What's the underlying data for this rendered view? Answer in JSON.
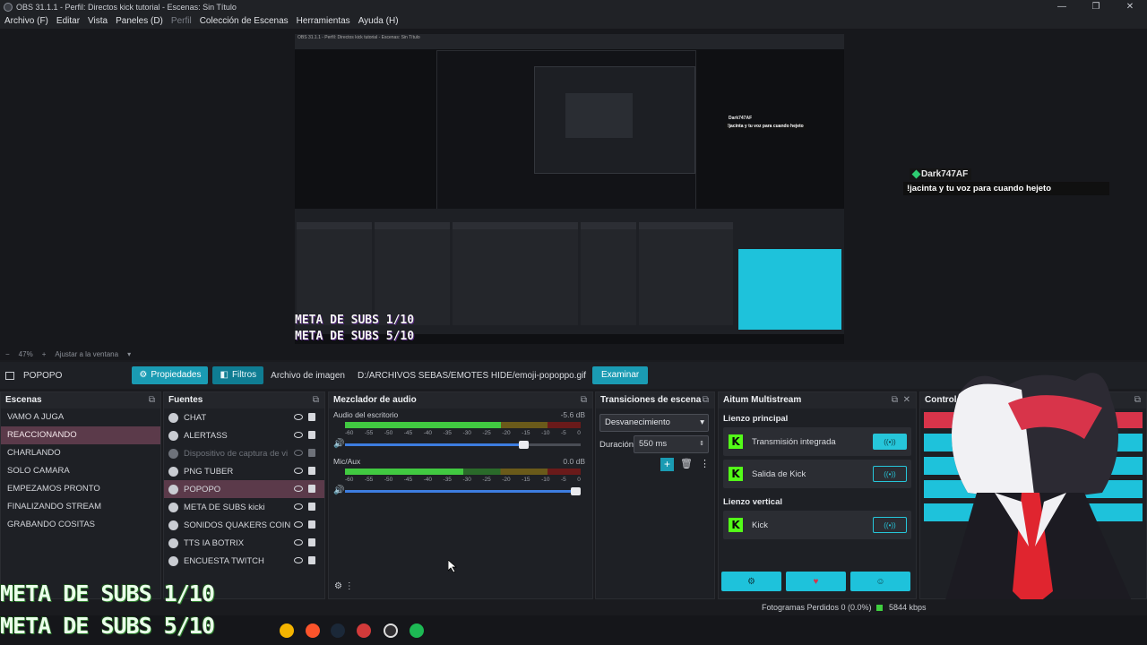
{
  "window": {
    "title": "OBS 31.1.1 - Perfil: Directos kick tutorial - Escenas: Sin Título",
    "minimize": "—",
    "maximize": "❐",
    "close": "✕"
  },
  "menu": [
    "Archivo (F)",
    "Editar",
    "Vista",
    "Paneles (D)",
    "Perfil",
    "Colección de Escenas",
    "Herramientas",
    "Ayuda (H)"
  ],
  "preview": {
    "nested_title": "OBS 31.1.1 - Perfil: Directos kick tutorial - Escenas: Sin Título",
    "meta1": "META DE SUBS 1/10",
    "meta2": "META DE SUBS 5/10",
    "chat_user": "Dark747AF",
    "chat_msg": "!jacinta y tu voz para cuando hejeto"
  },
  "zoombar": {
    "minus": "−",
    "zoom": "47%",
    "plus": "+",
    "fit": "Ajustar a la ventana"
  },
  "source_toolbar": {
    "current_source": "POPOPO",
    "properties": "Propiedades",
    "filters": "Filtros",
    "type_label": "Archivo de imagen",
    "path": "D:/ARCHIVOS SEBAS/EMOTES HIDE/emoji-popoppo.gif",
    "browse": "Examinar"
  },
  "scenes": {
    "title": "Escenas",
    "items": [
      "VAMO A JUGA",
      "REACCIONANDO",
      "CHARLANDO",
      "SOLO CAMARA",
      "EMPEZAMOS PRONTO",
      "FINALIZANDO STREAM",
      "GRABANDO COSITAS"
    ],
    "selected": 1
  },
  "sources": {
    "title": "Fuentes",
    "items": [
      "CHAT",
      "ALERTASS",
      "Dispositivo de captura de vi",
      "PNG TUBER",
      "POPOPO",
      "META DE SUBS kicki",
      "SONIDOS QUAKERS COIN",
      "TTS IA BOTRIX",
      "ENCUESTA TWITCH"
    ]
  },
  "mixer": {
    "title": "Mezclador de audio",
    "channels": [
      {
        "name": "Audio del escritorio",
        "db": "-5.6 dB",
        "level": 0.66,
        "volume": 0.77
      },
      {
        "name": "Mic/Aux",
        "db": "0.0 dB",
        "level": 0.5,
        "volume": 1.0
      }
    ],
    "ticks": [
      "-60",
      "-55",
      "-50",
      "-45",
      "-40",
      "-35",
      "-30",
      "-25",
      "-20",
      "-15",
      "-10",
      "-5",
      "0"
    ]
  },
  "transitions": {
    "title": "Transiciones de escena",
    "selected": "Desvanecimiento",
    "duration_label": "Duración",
    "duration": "550 ms"
  },
  "multistream": {
    "title": "Aitum Multistream",
    "main_label": "Lienzo principal",
    "main_items": [
      "Transmisión integrada",
      "Salida de Kick"
    ],
    "vertical_label": "Lienzo vertical",
    "vertical_items": [
      "Kick"
    ]
  },
  "controls": {
    "title": "Controles"
  },
  "status": {
    "dropped": "Fotogramas Perdidos 0 (0.0%)",
    "bitrate": "5844 kbps"
  },
  "overlay": {
    "meta1": "META DE SUBS 1/10",
    "meta2": "META DE SUBS 5/10"
  },
  "colors": {
    "accent": "#1a9bb3",
    "selected": "#5b3a4a",
    "kick": "#53fc18",
    "toggle": "#26c6da"
  }
}
